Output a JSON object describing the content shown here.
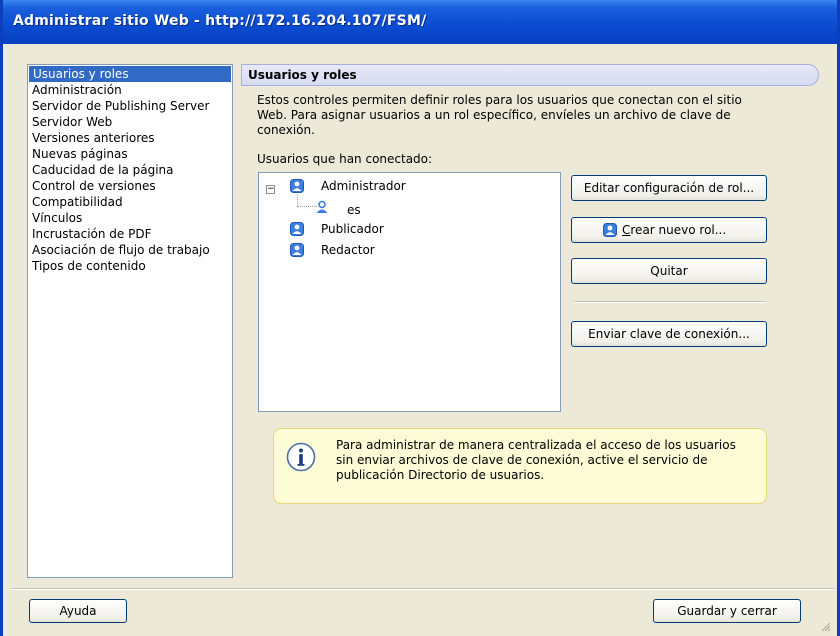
{
  "window": {
    "title": "Administrar sitio Web - http://172.16.204.107/FSM/"
  },
  "sidebar": {
    "items": [
      {
        "label": "Usuarios y roles",
        "selected": true
      },
      {
        "label": "Administración"
      },
      {
        "label": "Servidor de Publishing Server"
      },
      {
        "label": "Servidor Web"
      },
      {
        "label": "Versiones anteriores"
      },
      {
        "label": "Nuevas páginas"
      },
      {
        "label": "Caducidad de la página"
      },
      {
        "label": "Control de versiones"
      },
      {
        "label": "Compatibilidad"
      },
      {
        "label": "Vínculos"
      },
      {
        "label": "Incrustación de PDF"
      },
      {
        "label": "Asociación de flujo de trabajo"
      },
      {
        "label": "Tipos de contenido"
      }
    ]
  },
  "main": {
    "title": "Usuarios y roles",
    "description": "Estos controles permiten definir roles para los usuarios que conectan con el sitio Web. Para asignar usuarios a un rol específico, envíeles un archivo de clave de conexión.",
    "users_label": "Usuarios que han conectado:",
    "tree": {
      "expander": "−",
      "administrator": "Administrador",
      "child": "es",
      "publisher": "Publicador",
      "editor": "Redactor"
    },
    "buttons": {
      "edit_role": "Editar configuración de rol...",
      "create_role_prefix": "C",
      "create_role_rest": "rear nuevo rol...",
      "remove": "Quitar",
      "send_key": "Enviar clave de conexión..."
    },
    "info": {
      "text": "Para administrar de manera centralizada el acceso de los usuarios sin enviar archivos de clave de conexión, active el servicio de publicación Directorio de usuarios."
    }
  },
  "footer": {
    "help_label": "Ayuda",
    "save_close_label": "Guardar y cerrar"
  },
  "colors": {
    "titlebar": "#0a4bd0",
    "selection": "#316ac5",
    "user_icon": "#3a7fe0",
    "info_bg": "#fefcd6"
  }
}
